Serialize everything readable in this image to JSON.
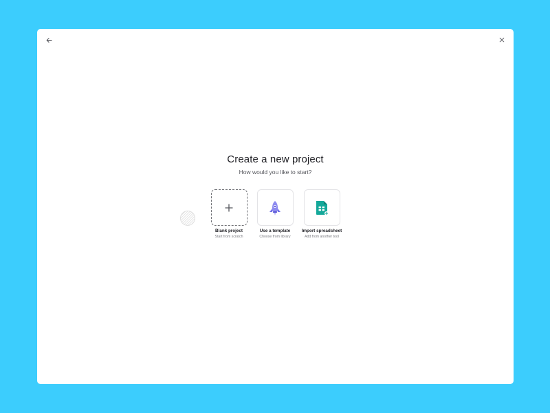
{
  "dialog": {
    "title": "Create a new project",
    "subtitle": "How would you like to start?"
  },
  "icons": {
    "back": "arrow-left-icon",
    "close": "close-icon",
    "loader": "loading-spinner"
  },
  "options": [
    {
      "label": "Blank project",
      "description": "Start from scratch",
      "icon": "plus-icon"
    },
    {
      "label": "Use a template",
      "description": "Choose from library",
      "icon": "rocket-icon"
    },
    {
      "label": "Import spreadsheet",
      "description": "Add from another tool",
      "icon": "spreadsheet-icon"
    }
  ],
  "colors": {
    "background": "#3ccdfd",
    "rocket": "#7472e8",
    "spreadsheet": "#14a89a"
  }
}
